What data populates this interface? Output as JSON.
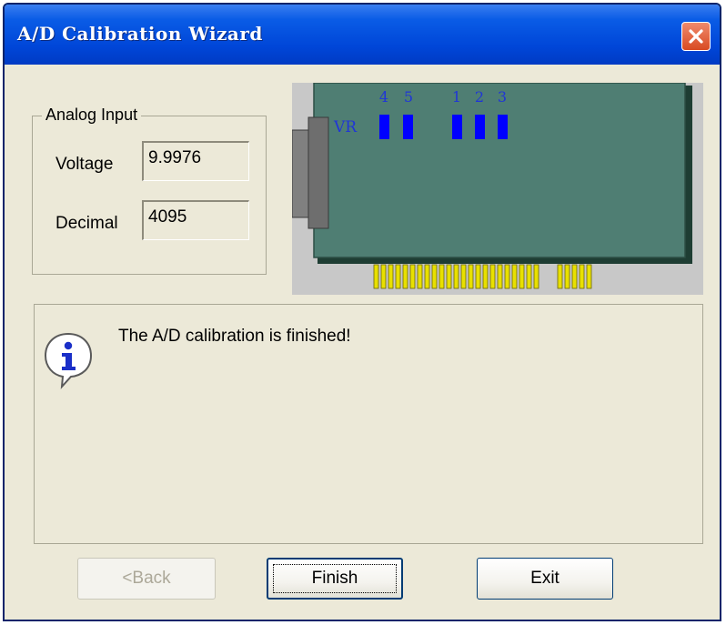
{
  "window": {
    "title": "A/D Calibration Wizard",
    "close_icon": "close-x-icon"
  },
  "analog_input": {
    "legend": "Analog Input",
    "voltage_label": "Voltage",
    "voltage_value": "9.9976",
    "decimal_label": "Decimal",
    "decimal_value": "4095"
  },
  "board": {
    "vr_label": "VR",
    "jumper_labels": [
      "4",
      "5",
      "1",
      "2",
      "3"
    ],
    "colors": {
      "pcb": "#4f7e73",
      "jumper": "#0000ff",
      "connector": "#e8e000"
    }
  },
  "message": {
    "icon": "info-icon",
    "text": "The A/D calibration is finished!"
  },
  "buttons": {
    "back": "<Back",
    "finish": "Finish",
    "exit": "Exit"
  }
}
